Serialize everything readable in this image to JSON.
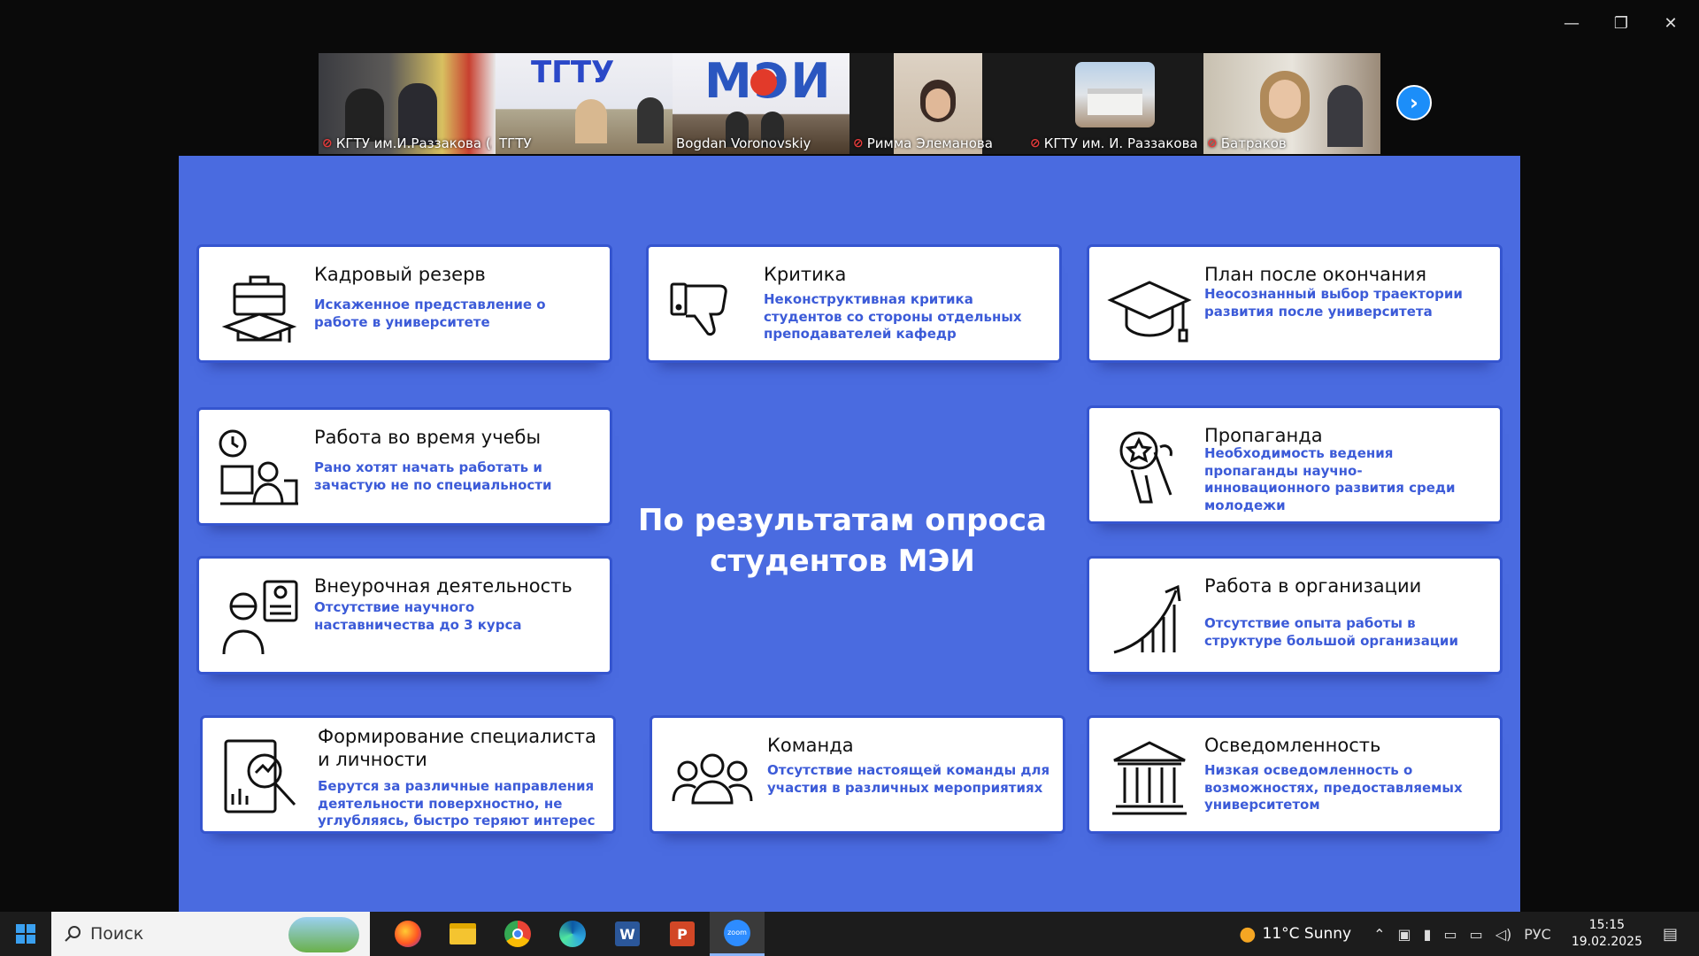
{
  "window": {
    "minimize": "—",
    "maximize": "❐",
    "close": "✕"
  },
  "participants": [
    {
      "name": "КГТУ им.И.Раззакова (...",
      "muted": true,
      "active": false
    },
    {
      "name": "ТГТУ",
      "muted": false,
      "active": false
    },
    {
      "name": "Bogdan Voronovskiy",
      "muted": false,
      "active": true
    },
    {
      "name": "Римма Элеманова",
      "muted": true,
      "active": false
    },
    {
      "name": "КГТУ им. И. Раззакова",
      "muted": true,
      "active": false
    },
    {
      "name": "Батраков",
      "muted": true,
      "active": false
    }
  ],
  "tile_logos": {
    "tgtu": "ТГТУ",
    "mei": "МЭИ"
  },
  "slide": {
    "center_title": "По результатам опроса студентов МЭИ",
    "cards": {
      "reserve": {
        "title": "Кадровый резерв",
        "desc": "Искаженное представление о работе в университете",
        "icon": "briefcase-cap-icon"
      },
      "criticism": {
        "title": "Критика",
        "desc": "Неконструктивная критика студентов со стороны отдельных преподавателей кафедр",
        "icon": "thumbs-down-icon"
      },
      "plan": {
        "title": "План после окончания",
        "desc": "Неосознанный выбор траектории развития после университета",
        "icon": "graduation-cap-icon"
      },
      "work_study": {
        "title": "Работа во время учебы",
        "desc": "Рано хотят начать работать и зачастую не по специальности",
        "icon": "worker-clock-icon"
      },
      "propaganda": {
        "title": "Пропаганда",
        "desc": "Необходимость ведения пропаганды научно-инновационного развития среди молодежи",
        "icon": "torch-hand-icon"
      },
      "extra": {
        "title": "Внеурочная деятельность",
        "desc": "Отсутствие научного наставничества до 3 курса",
        "icon": "mentor-icon"
      },
      "org_work": {
        "title": "Работа в организации",
        "desc": "Отсутствие опыта работы в структуре большой организации",
        "icon": "growth-chart-icon"
      },
      "formation": {
        "title": "Формирование специалиста и личности",
        "desc": "Берутся за различные направления деятельности поверхностно, не углубляясь, быстро теряют интерес",
        "icon": "analysis-icon"
      },
      "team": {
        "title": "Команда",
        "desc": "Отсутствие настоящей команды для участия в различных мероприятиях",
        "icon": "team-icon"
      },
      "awareness": {
        "title": "Осведомленность",
        "desc": "Низкая осведомленность о возможностях, предоставляемых университетом",
        "icon": "institution-icon"
      }
    }
  },
  "taskbar": {
    "search_placeholder": "Поиск",
    "apps": [
      "firefox-icon",
      "explorer-icon",
      "chrome-icon",
      "edge-icon",
      "word-icon",
      "powerpoint-icon",
      "zoom-icon"
    ],
    "weather": "11°C  Sunny",
    "language": "РУС",
    "time": "15:15",
    "date": "19.02.2025"
  },
  "colors": {
    "slide_bg": "#4a6be0",
    "accent_text": "#3c5bd8",
    "active_tile": "#2ed573"
  }
}
